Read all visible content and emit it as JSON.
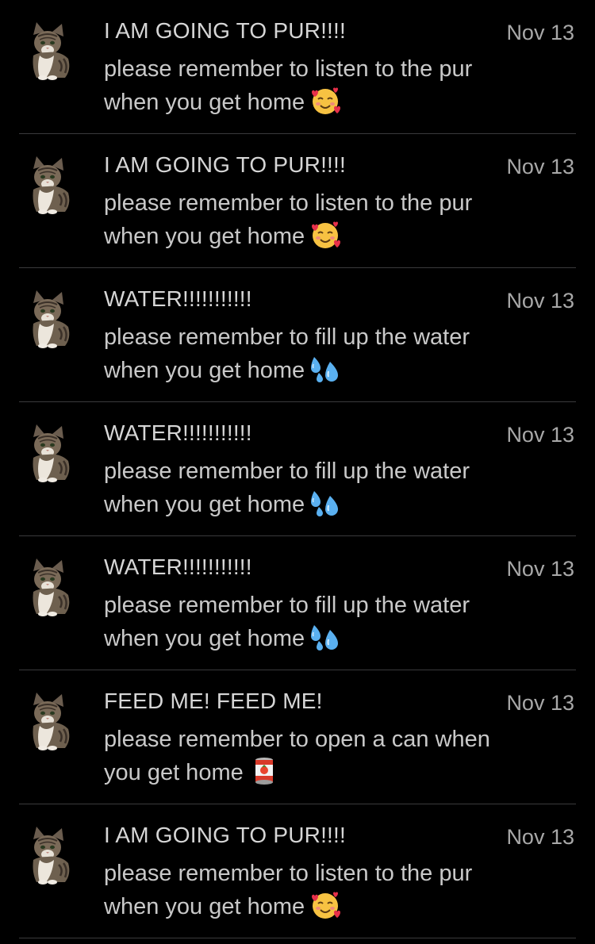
{
  "notifications": [
    {
      "sender": "I AM GOING TO PUR!!!!",
      "date": "Nov 13",
      "line1": "please remember to listen to the pur",
      "line2": "when you get home",
      "emoji": "smiling-face-with-hearts-icon"
    },
    {
      "sender": "I AM GOING TO PUR!!!!",
      "date": "Nov 13",
      "line1": "please remember to listen to the pur",
      "line2": "when you get home",
      "emoji": "smiling-face-with-hearts-icon"
    },
    {
      "sender": "WATER!!!!!!!!!!!",
      "date": "Nov 13",
      "line1": "please remember to fill up the water",
      "line2": "when you get home",
      "emoji": "sweat-droplets-icon"
    },
    {
      "sender": "WATER!!!!!!!!!!!",
      "date": "Nov 13",
      "line1": "please remember to fill up the water",
      "line2": "when you get home",
      "emoji": "sweat-droplets-icon"
    },
    {
      "sender": "WATER!!!!!!!!!!!",
      "date": "Nov 13",
      "line1": "please remember to fill up the water",
      "line2": "when you get home",
      "emoji": "sweat-droplets-icon"
    },
    {
      "sender": "FEED ME! FEED ME!",
      "date": "Nov 13",
      "line1": "please remember to open a can when",
      "line2": "you get home",
      "emoji": "canned-food-icon"
    },
    {
      "sender": "I AM GOING TO PUR!!!!",
      "date": "Nov 13",
      "line1": "please remember to listen to the pur",
      "line2": "when you get home",
      "emoji": "smiling-face-with-hearts-icon"
    }
  ],
  "colors": {
    "background": "#000000",
    "divider": "#3a3a3c",
    "sender_text": "#d6d6d6",
    "body_text": "#c9c9c9",
    "date_text": "#a8a8a8"
  }
}
